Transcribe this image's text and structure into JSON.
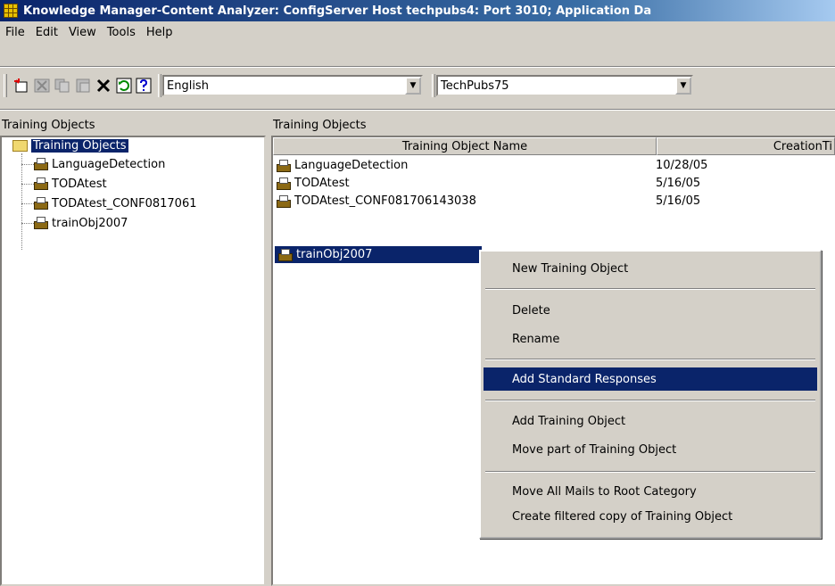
{
  "window": {
    "title": "Knowledge Manager-Content Analyzer: ConfigServer Host techpubs4: Port 3010; Application Da"
  },
  "menu": [
    "File",
    "Edit",
    "View",
    "Tools",
    "Help"
  ],
  "toolbar": {
    "language": "English",
    "tenant": "TechPubs75"
  },
  "left_panel": {
    "label": "Training Objects",
    "root": "Training Objects",
    "items": [
      "LanguageDetection",
      "TODAtest",
      "TODAtest_CONF0817061",
      "trainObj2007"
    ]
  },
  "right_panel": {
    "label": "Training Objects",
    "columns": [
      "Training Object Name",
      "CreationTi"
    ],
    "rows": [
      {
        "name": "LanguageDetection",
        "created": "10/28/05"
      },
      {
        "name": "TODAtest",
        "created": "5/16/05"
      },
      {
        "name": "TODAtest_CONF081706143038",
        "created": "5/16/05"
      },
      {
        "name": "trainObj2007",
        "created": ""
      }
    ]
  },
  "context_menu": {
    "items": [
      "New Training Object",
      "Delete",
      "Rename",
      "Add Standard Responses",
      "Add Training Object",
      "Move part of Training Object",
      "Move All Mails to Root Category",
      "Create filtered copy of Training Object"
    ]
  }
}
